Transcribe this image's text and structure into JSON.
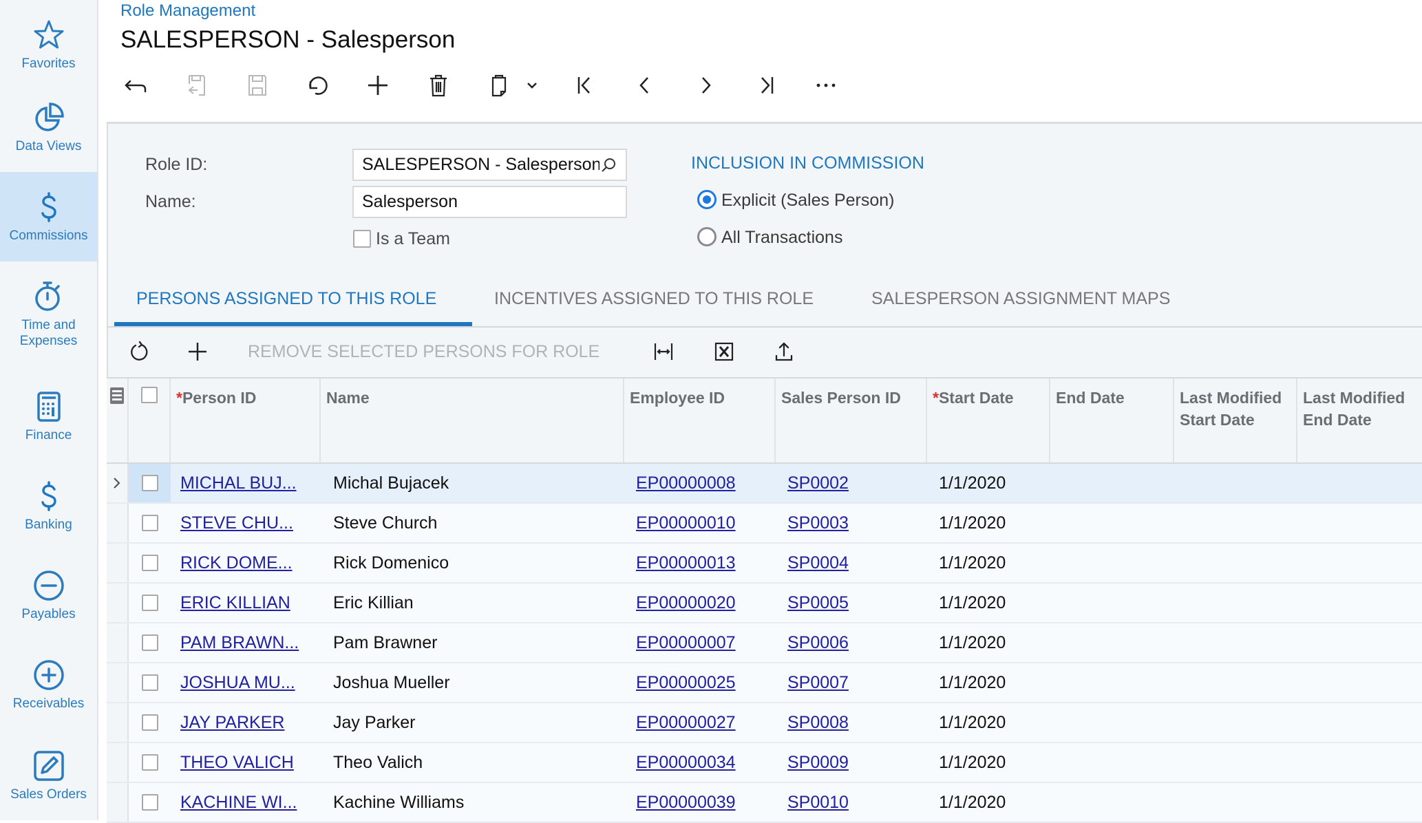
{
  "sidebar": {
    "items": [
      {
        "label": "Favorites",
        "icon": "star-icon",
        "active": false
      },
      {
        "label": "Data Views",
        "icon": "pie-chart-icon",
        "active": false
      },
      {
        "label": "Commissions",
        "icon": "dollar-icon",
        "active": true
      },
      {
        "label": "Time and Expenses",
        "icon": "stopwatch-icon",
        "active": false
      },
      {
        "label": "Finance",
        "icon": "calculator-icon",
        "active": false
      },
      {
        "label": "Banking",
        "icon": "dollar-icon",
        "active": false
      },
      {
        "label": "Payables",
        "icon": "minus-circle-icon",
        "active": false
      },
      {
        "label": "Receivables",
        "icon": "plus-circle-icon",
        "active": false
      },
      {
        "label": "Sales Orders",
        "icon": "pencil-square-icon",
        "active": false
      }
    ]
  },
  "header": {
    "breadcrumb": "Role Management",
    "title": "SALESPERSON - Salesperson"
  },
  "toolbar": {
    "icons": [
      "back-icon",
      "save-and-close-icon",
      "save-icon",
      "undo-icon",
      "add-icon",
      "delete-icon",
      "clipboard-icon",
      "chevron-down-icon",
      "first-record-icon",
      "previous-record-icon",
      "next-record-icon",
      "last-record-icon",
      "more-icon"
    ]
  },
  "form": {
    "role_id_label": "Role ID:",
    "role_id_value": "SALESPERSON - Salesperson",
    "name_label": "Name:",
    "name_value": "Salesperson",
    "is_team_label": "Is a Team",
    "is_team_checked": false,
    "inclusion_header": "INCLUSION IN COMMISSION",
    "radio_explicit": "Explicit (Sales Person)",
    "radio_all": "All Transactions",
    "selected_radio": "explicit"
  },
  "tabs": [
    {
      "label": "PERSONS ASSIGNED TO THIS ROLE",
      "active": true
    },
    {
      "label": "INCENTIVES ASSIGNED TO THIS ROLE",
      "active": false
    },
    {
      "label": "SALESPERSON ASSIGNMENT MAPS",
      "active": false
    }
  ],
  "grid_toolbar": {
    "remove_label": "REMOVE SELECTED PERSONS FOR ROLE"
  },
  "grid": {
    "columns": [
      {
        "label": "Person ID",
        "required": true
      },
      {
        "label": "Name",
        "required": false
      },
      {
        "label": "Employee ID",
        "required": false
      },
      {
        "label": "Sales Person ID",
        "required": false
      },
      {
        "label": "Start Date",
        "required": true
      },
      {
        "label": "End Date",
        "required": false
      },
      {
        "label": "Last Modified Start Date",
        "required": false
      },
      {
        "label": "Last Modified End Date",
        "required": false
      }
    ],
    "rows": [
      {
        "person_id": "MICHAL BUJ...",
        "name": "Michal Bujacek",
        "employee_id": "EP00000008",
        "sales_person_id": "SP0002",
        "start_date": "1/1/2020",
        "end_date": "",
        "lm_start": "",
        "lm_end": "",
        "selected": true
      },
      {
        "person_id": "STEVE CHU...",
        "name": "Steve Church",
        "employee_id": "EP00000010",
        "sales_person_id": "SP0003",
        "start_date": "1/1/2020",
        "end_date": "",
        "lm_start": "",
        "lm_end": "",
        "selected": false
      },
      {
        "person_id": "RICK DOME...",
        "name": "Rick Domenico",
        "employee_id": "EP00000013",
        "sales_person_id": "SP0004",
        "start_date": "1/1/2020",
        "end_date": "",
        "lm_start": "",
        "lm_end": "",
        "selected": false
      },
      {
        "person_id": "ERIC KILLIAN",
        "name": "Eric Killian",
        "employee_id": "EP00000020",
        "sales_person_id": "SP0005",
        "start_date": "1/1/2020",
        "end_date": "",
        "lm_start": "",
        "lm_end": "",
        "selected": false
      },
      {
        "person_id": "PAM BRAWN...",
        "name": "Pam Brawner",
        "employee_id": "EP00000007",
        "sales_person_id": "SP0006",
        "start_date": "1/1/2020",
        "end_date": "",
        "lm_start": "",
        "lm_end": "",
        "selected": false
      },
      {
        "person_id": "JOSHUA MU...",
        "name": "Joshua Mueller",
        "employee_id": "EP00000025",
        "sales_person_id": "SP0007",
        "start_date": "1/1/2020",
        "end_date": "",
        "lm_start": "",
        "lm_end": "",
        "selected": false
      },
      {
        "person_id": "JAY PARKER",
        "name": "Jay Parker",
        "employee_id": "EP00000027",
        "sales_person_id": "SP0008",
        "start_date": "1/1/2020",
        "end_date": "",
        "lm_start": "",
        "lm_end": "",
        "selected": false
      },
      {
        "person_id": "THEO VALICH",
        "name": "Theo Valich",
        "employee_id": "EP00000034",
        "sales_person_id": "SP0009",
        "start_date": "1/1/2020",
        "end_date": "",
        "lm_start": "",
        "lm_end": "",
        "selected": false
      },
      {
        "person_id": "KACHINE WI...",
        "name": "Kachine Williams",
        "employee_id": "EP00000039",
        "sales_person_id": "SP0010",
        "start_date": "1/1/2020",
        "end_date": "",
        "lm_start": "",
        "lm_end": "",
        "selected": false
      }
    ]
  },
  "colors": {
    "accent": "#1f77c0",
    "link": "#2121a0",
    "required": "#d93030",
    "selected_row": "#e5f0fa",
    "sidebar_active": "#cfe4f6"
  }
}
